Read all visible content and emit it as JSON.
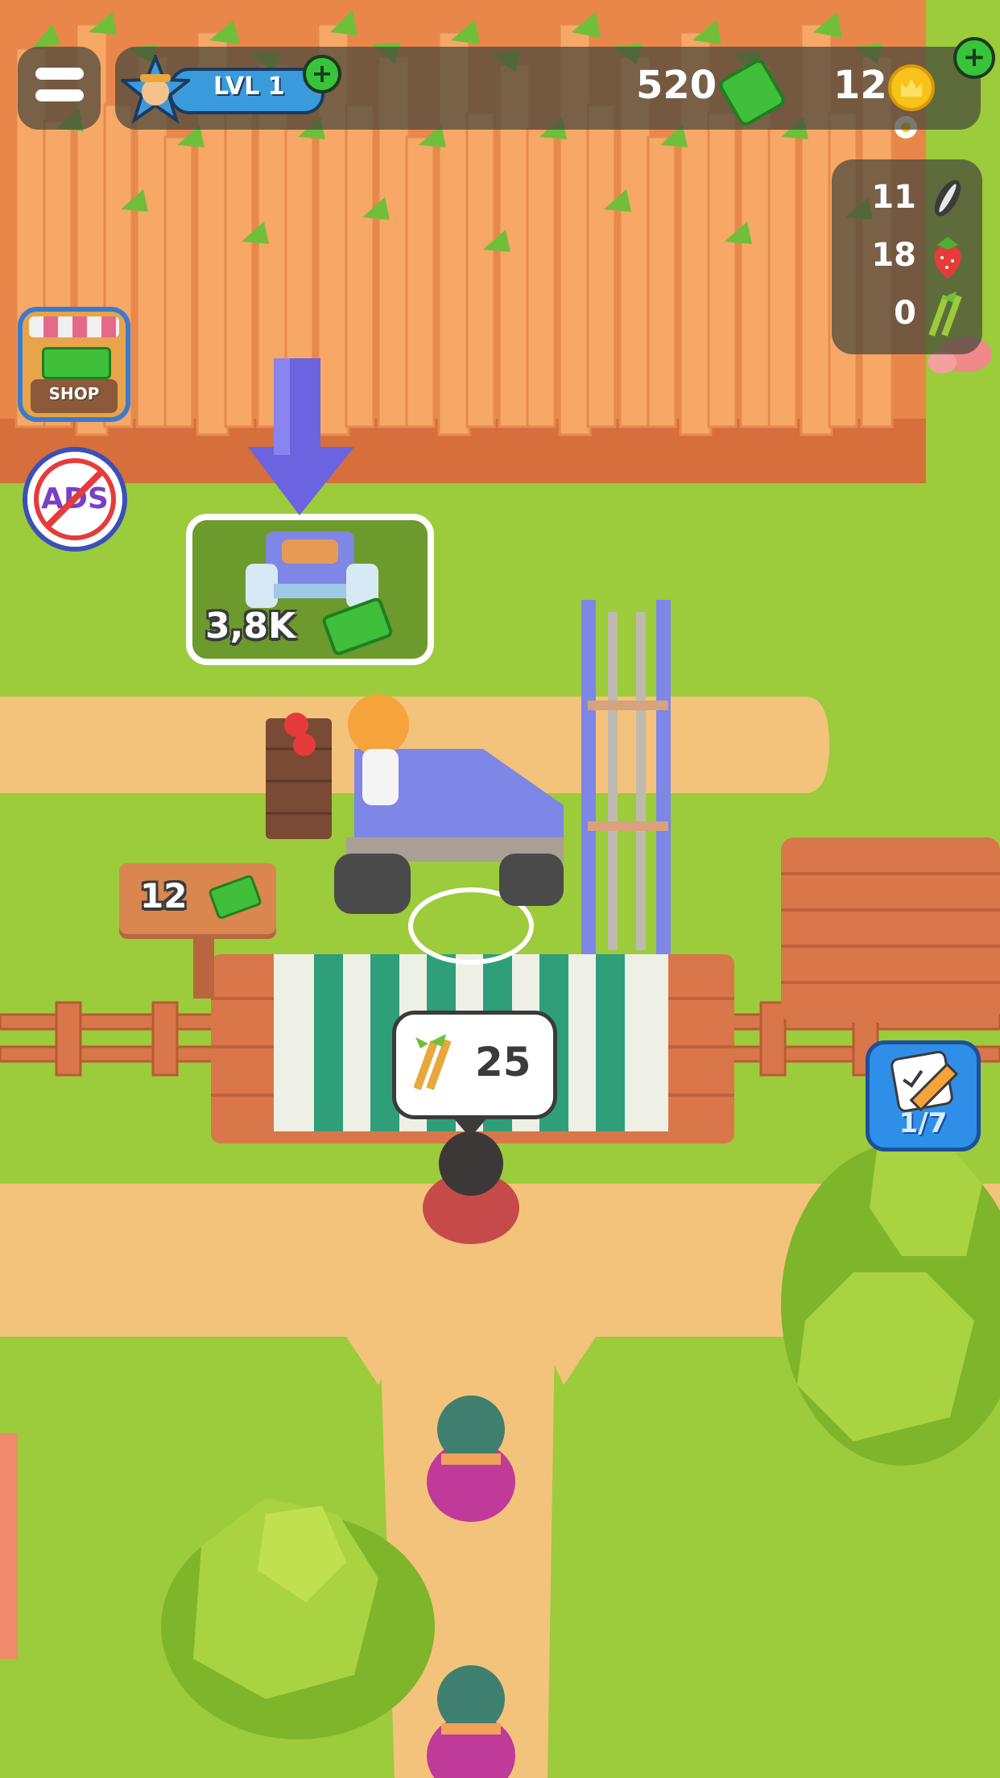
{
  "hud": {
    "level_label": "LVL 1",
    "cash_amount": "520",
    "coin_amount": "12"
  },
  "resources": [
    {
      "count": "11",
      "icon": "sunflower-seed-icon"
    },
    {
      "count": "18",
      "icon": "strawberry-icon"
    },
    {
      "count": "0",
      "icon": "sugarcane-icon"
    }
  ],
  "side_buttons": {
    "shop_label": "SHOP",
    "no_ads_label": "ADS"
  },
  "world": {
    "upgrade_price": "3,8K",
    "sign_price": "12",
    "customer_request_count": "25",
    "tasks_progress": "1/7"
  },
  "colors": {
    "grass": "#9ccb3b",
    "path": "#f3c37c",
    "crop": "#f59b5a",
    "level_bar": "#3a9bdc",
    "cash_green": "#3fbf3a",
    "coin_gold": "#f7c21a",
    "arrow": "#6b63e0",
    "task_button": "#2f8fe8"
  }
}
